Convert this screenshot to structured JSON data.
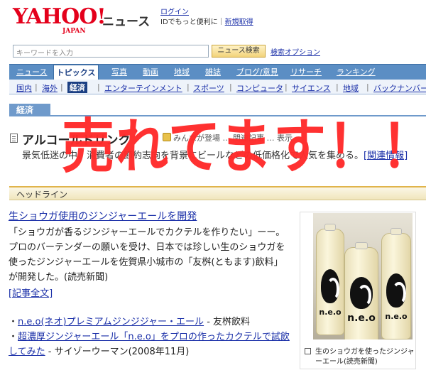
{
  "header": {
    "logo_text": "YAHOO!",
    "logo_sub": "JAPAN",
    "service": "ニュース",
    "login_link": "ログイン",
    "login_note": "IDでもっと便利に",
    "signup_link": "新規取得"
  },
  "search": {
    "placeholder": "キーワードを入力",
    "button": "ニュース検索",
    "options": "検索オプション"
  },
  "tabs": [
    {
      "label": "ニュース"
    },
    {
      "label": "トピックス"
    },
    {
      "label": "写真"
    },
    {
      "label": "動画"
    },
    {
      "label": "地域"
    },
    {
      "label": "雑誌"
    },
    {
      "label": "ブログ/意見"
    },
    {
      "label": "リサーチ"
    },
    {
      "label": "ランキング"
    }
  ],
  "subnav": [
    {
      "label": "国内"
    },
    {
      "label": "海外"
    },
    {
      "label": "経済"
    },
    {
      "label": "エンターテインメント"
    },
    {
      "label": "スポーツ"
    },
    {
      "label": "コンピュータ"
    },
    {
      "label": "サイエンス"
    },
    {
      "label": "地域"
    },
    {
      "label": "バックナンバー"
    }
  ],
  "category": "経済",
  "topic": {
    "title": "アルコールドリンク",
    "meta": "みんなが登場 … 関連記事 … 表示",
    "summary": "景気低迷の中、消費者の節約志向を背景にビールなどの低価格化で人気を集める。",
    "related_link": "[関連情報]"
  },
  "headline": {
    "label": "ヘッドライン",
    "title": "生ショウガ使用のジンジャーエールを開発",
    "body": "「ショウガが香るジンジャーエールでカクテルを作りたい」ーー。プロのバーテンダーの願いを受け、日本では珍しい生のショウガを使ったジンジャーエールを佐賀県小城市の「友桝(ともます)飲料」が開発した。(読売新聞)",
    "full_text": "[記事全文]"
  },
  "related": [
    {
      "bullet": "・",
      "link": "n.e.o(ネオ)プレミアムジンジジャー・エール",
      "suffix": " - 友桝飲料"
    },
    {
      "bullet": "・",
      "link": "超濃厚ジンジャーエール「n.e.o」をプロの作ったカクテルで試飲してみた",
      "suffix": " - サイゾーウーマン(2008年11月)"
    }
  ],
  "photo": {
    "bottle_label": "n.e.o",
    "caption": "生のショウガを使ったジンジャーエール(読売新聞)"
  },
  "overlay_text": "売れてます！！",
  "colors": {
    "accent_red": "#ff2b2b",
    "nav_blue": "#5b8ec4",
    "link_blue": "#1a2fa8"
  }
}
